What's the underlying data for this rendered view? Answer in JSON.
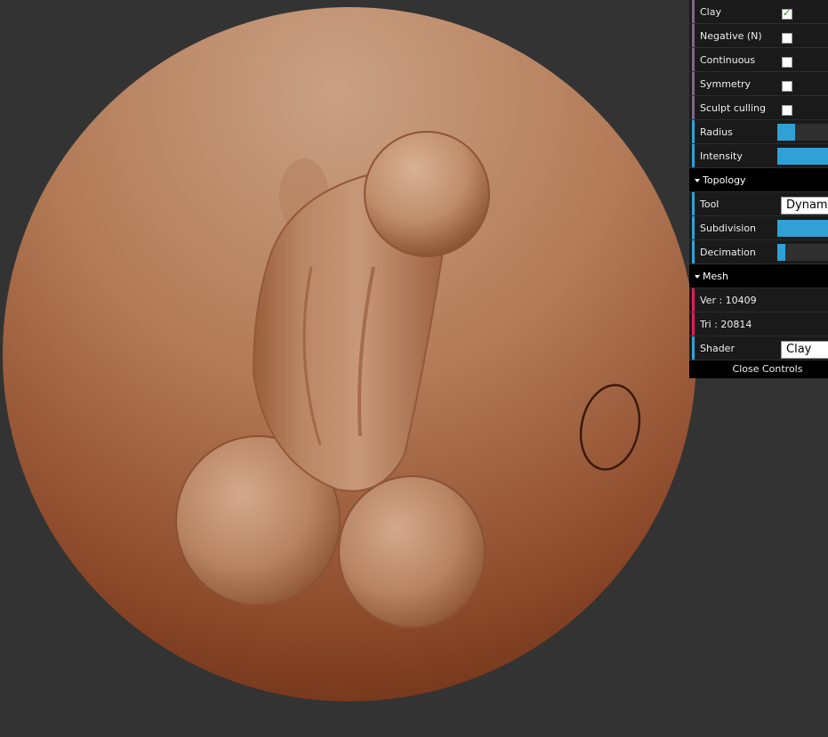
{
  "gui": {
    "sculpt": {
      "clay_label": "Clay",
      "clay_checked": true,
      "negative_label": "Negative (N)",
      "continuous_label": "Continuous",
      "symmetry_label": "Symmetry",
      "culling_label": "Sculpt culling",
      "radius_label": "Radius",
      "radius_fraction": 0.35,
      "intensity_label": "Intensity",
      "intensity_fraction": 1.0
    },
    "topology": {
      "folder_label": "Topology",
      "tool_label": "Tool",
      "tool_value": "Dynamic",
      "subdivision_label": "Subdivision",
      "subdivision_fraction": 1.0,
      "decimation_label": "Decimation",
      "decimation_fraction": 0.15
    },
    "mesh": {
      "folder_label": "Mesh",
      "vertices_text": "Ver : 10409",
      "triangles_text": "Tri : 20814",
      "shader_label": "Shader",
      "shader_value": "Clay"
    },
    "close_label": "Close Controls"
  },
  "colors": {
    "background": "#333333",
    "clay_light": "#c9a184",
    "clay_dark": "#6b2e15",
    "accent_blue": "#2fa1d6",
    "accent_purple": "#806787",
    "accent_red": "#e61d5f"
  },
  "icons": {
    "folder_toggle": "triangle-down-icon",
    "brush_cursor": "circle-outline-icon"
  }
}
